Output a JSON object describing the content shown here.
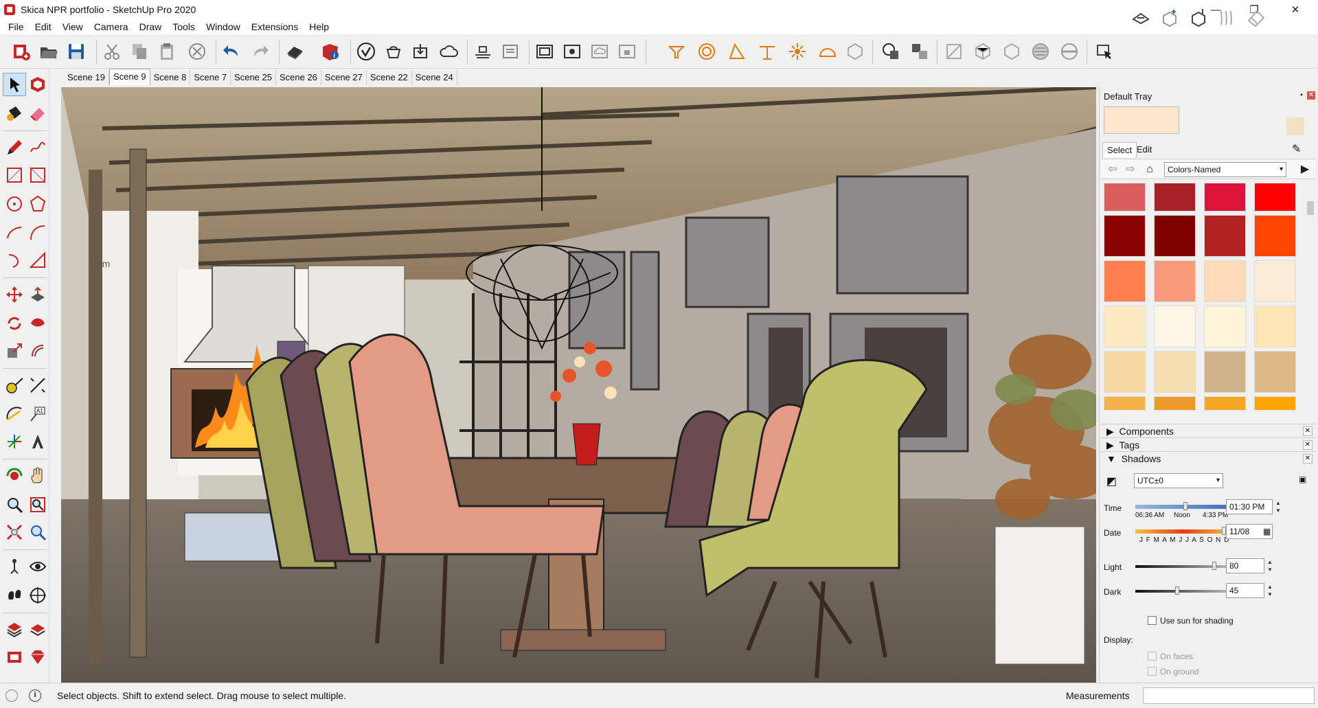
{
  "window": {
    "title": "Skica NPR portfolio - SketchUp Pro 2020",
    "minimize": "—",
    "maximize": "❐",
    "close": "✕"
  },
  "menu": [
    "File",
    "Edit",
    "View",
    "Camera",
    "Draw",
    "Tools",
    "Window",
    "Extensions",
    "Help"
  ],
  "scenes": {
    "tabs": [
      "Scene 19",
      "Scene 9",
      "Scene 8",
      "Scene 7",
      "Scene 25",
      "Scene 26",
      "Scene 27",
      "Scene 22",
      "Scene 24"
    ],
    "active": "Scene 9"
  },
  "viewport": {
    "annotation": "mm"
  },
  "tray": {
    "title": "Default Tray",
    "pin": "▪",
    "close": "✕",
    "materials": {
      "tab_select": "Select",
      "tab_edit": "Edit",
      "collection": "Colors-Named",
      "swatch_rows": [
        [
          "#d95e5e",
          "#a72227",
          "#dc143c",
          "#ff0000"
        ],
        [
          "#8b0000",
          "#800000",
          "#b22222",
          "#ff4500"
        ],
        [
          "#ff7f50",
          "#fa9a7a",
          "#ffdab9",
          "#faebd7"
        ],
        [
          "#fde9c4",
          "#fdf5e6",
          "#fff3d9",
          "#ffe4b5"
        ],
        [
          "#f8d8a2",
          "#f6ddb2",
          "#d2b48c",
          "#deb887"
        ],
        [
          "#f3b04b",
          "#ee9a2a",
          "#f5a623",
          "#ffa500"
        ]
      ]
    },
    "panels": {
      "components": "Components",
      "tags": "Tags",
      "shadows": "Shadows"
    },
    "shadows": {
      "timezone": "UTC±0",
      "time_label": "Time",
      "time_sunrise": "06:36 AM",
      "time_noon": "Noon",
      "time_sunset": "4:33 PM",
      "time_value": "01:30 PM",
      "date_label": "Date",
      "months": "J F M A M J J A S O N D",
      "date_value": "11/08",
      "light_label": "Light",
      "light_value": "80",
      "dark_label": "Dark",
      "dark_value": "45",
      "use_sun_label": "Use sun for shading",
      "display_label": "Display:",
      "on_faces_label": "On faces",
      "on_ground_label": "On ground"
    }
  },
  "status": {
    "hint": "Select objects. Shift to extend select. Drag mouse to select multiple.",
    "measurements_label": "Measurements",
    "info_icon": "i"
  }
}
